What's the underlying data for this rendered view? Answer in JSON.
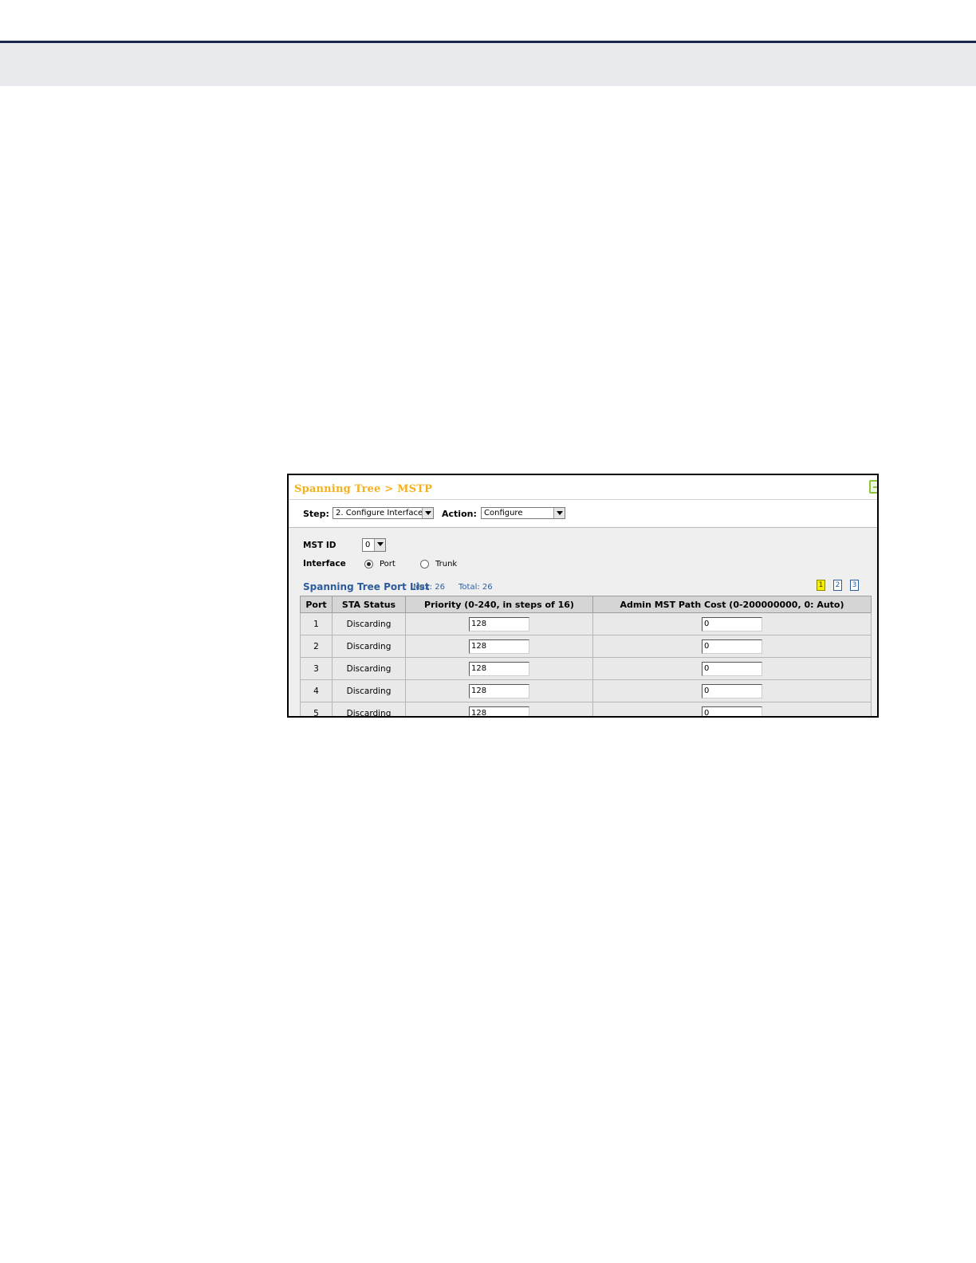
{
  "window": {
    "title": "Spanning Tree > MSTP"
  },
  "toolbar": {
    "step_label": "Step:",
    "step_value": "2. Configure Interface",
    "action_label": "Action:",
    "action_value": "Configure"
  },
  "form": {
    "mst_id_label": "MST ID",
    "mst_id_value": "0",
    "interface_label": "Interface",
    "interface_options": [
      "Port",
      "Trunk"
    ],
    "interface_selected": "Port"
  },
  "list": {
    "title": "Spanning Tree Port List",
    "max": "Max: 26",
    "total": "Total: 26",
    "pages": [
      "1",
      "2",
      "3"
    ],
    "current_page": "1"
  },
  "table": {
    "columns": [
      "Port",
      "STA Status",
      "Priority (0-240, in steps of 16)",
      "Admin MST Path Cost (0-200000000, 0: Auto)"
    ],
    "rows": [
      {
        "port": "1",
        "status": "Discarding",
        "priority": "128",
        "cost": "0"
      },
      {
        "port": "2",
        "status": "Discarding",
        "priority": "128",
        "cost": "0"
      },
      {
        "port": "3",
        "status": "Discarding",
        "priority": "128",
        "cost": "0"
      },
      {
        "port": "4",
        "status": "Discarding",
        "priority": "128",
        "cost": "0"
      },
      {
        "port": "5",
        "status": "Discarding",
        "priority": "128",
        "cost": "0"
      }
    ]
  },
  "icons": {
    "corner": "page-icon",
    "dropdown": "chevron-down-icon",
    "radio": "radio-icon"
  },
  "colors": {
    "title": "#f2b11d",
    "link": "#2d5c9c",
    "current_page": "#f6f000",
    "header_rule": "#1b2a4a"
  }
}
